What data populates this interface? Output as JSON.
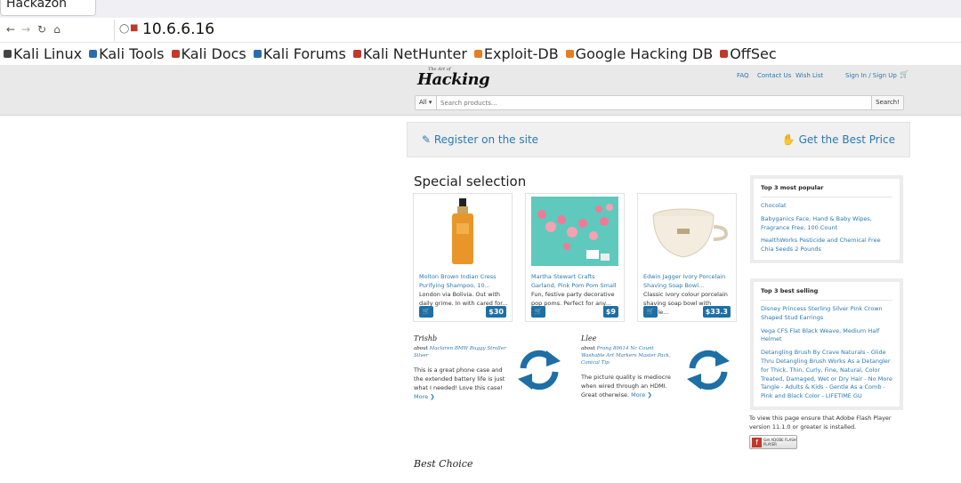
{
  "browser": {
    "tab_title": "Hackazon",
    "url": "10.6.6.16",
    "bookmarks": [
      {
        "label": "Kali Linux",
        "color": "#444444"
      },
      {
        "label": "Kali Tools",
        "color": "#2b6cb0"
      },
      {
        "label": "Kali Docs",
        "color": "#c0392b"
      },
      {
        "label": "Kali Forums",
        "color": "#2b6cb0"
      },
      {
        "label": "Kali NetHunter",
        "color": "#c0392b"
      },
      {
        "label": "Exploit-DB",
        "color": "#e67e22"
      },
      {
        "label": "Google Hacking DB",
        "color": "#e67e22"
      },
      {
        "label": "OffSec",
        "color": "#c0392b"
      }
    ]
  },
  "header": {
    "logo_small": "The Art of",
    "logo": "Hacking",
    "links": [
      "FAQ",
      "Contact Us",
      "Wish List"
    ],
    "signin": "Sign In / Sign Up",
    "search_category": "All",
    "search_placeholder": "Search products...",
    "search_button": "Search!"
  },
  "banner": {
    "register": "Register on the site",
    "best_price": "Get the Best Price"
  },
  "special_selection": {
    "title": "Special selection",
    "products": [
      {
        "title": "Molton Brown Indian Cress Purifying Shampoo, 10...",
        "desc": "London via Bolivia. Out with daily grime. In with cared for...",
        "price": "$30"
      },
      {
        "title": "Martha Stewart Crafts Garland, Pink Pom Pom Small",
        "desc": "Fun, festive party decorative pop poms. Perfect for any...",
        "price": "$9"
      },
      {
        "title": "Edwin Jagger Ivory Porcelain Shaving Soap Bowl...",
        "desc": "Classic ivory colour porcelain shaving soap bowl with handle...",
        "price": "$33.3"
      }
    ]
  },
  "reviews": [
    {
      "name": "Trishb",
      "about_prefix": "about",
      "about": "Maclaren BMW Buggy Stroller Silver",
      "text": "This is a great phone case and the extended battery life is just what I needed! Love this case!",
      "more": "More"
    },
    {
      "name": "Llee",
      "about_prefix": "about",
      "about": "Prang 80614 Nc Count Washable Art Markers Master Pack, Conical Tip",
      "text": "The picture quality is mediocre when wired through an HDMI. Great otherwise.",
      "more": "More"
    }
  ],
  "sidebar": {
    "popular_title": "Top 3 most popular",
    "popular": [
      "Chocolat",
      "Babyganics Face, Hand & Baby Wipes, Fragrance Free, 100 Count",
      "HealthWorks Pesticide and Chemical Free Chia Seeds 2 Pounds"
    ],
    "selling_title": "Top 3 best selling",
    "selling": [
      "Disney Princess Sterling Silver Pink Crown Shaped Stud Earrings",
      "Vega CFS Flat Black Weave, Medium Half Helmet",
      "Detangling Brush By Crave Naturals - Glide Thru Detangling Brush Works As a Detangler for Thick, Thin, Curly, Fine, Natural, Color Treated, Damaged, Wet or Dry Hair - No More Tangle - Adults & Kids - Gentle As a Comb - Pink and Black Color - LIFETIME GU"
    ],
    "flash_text": "To view this page ensure that Adobe Flash Player version 11.1.0 or greater is installed.",
    "flash_badge": "Get ADOBE FLASH PLAYER"
  },
  "best_choice": "Best Choice"
}
